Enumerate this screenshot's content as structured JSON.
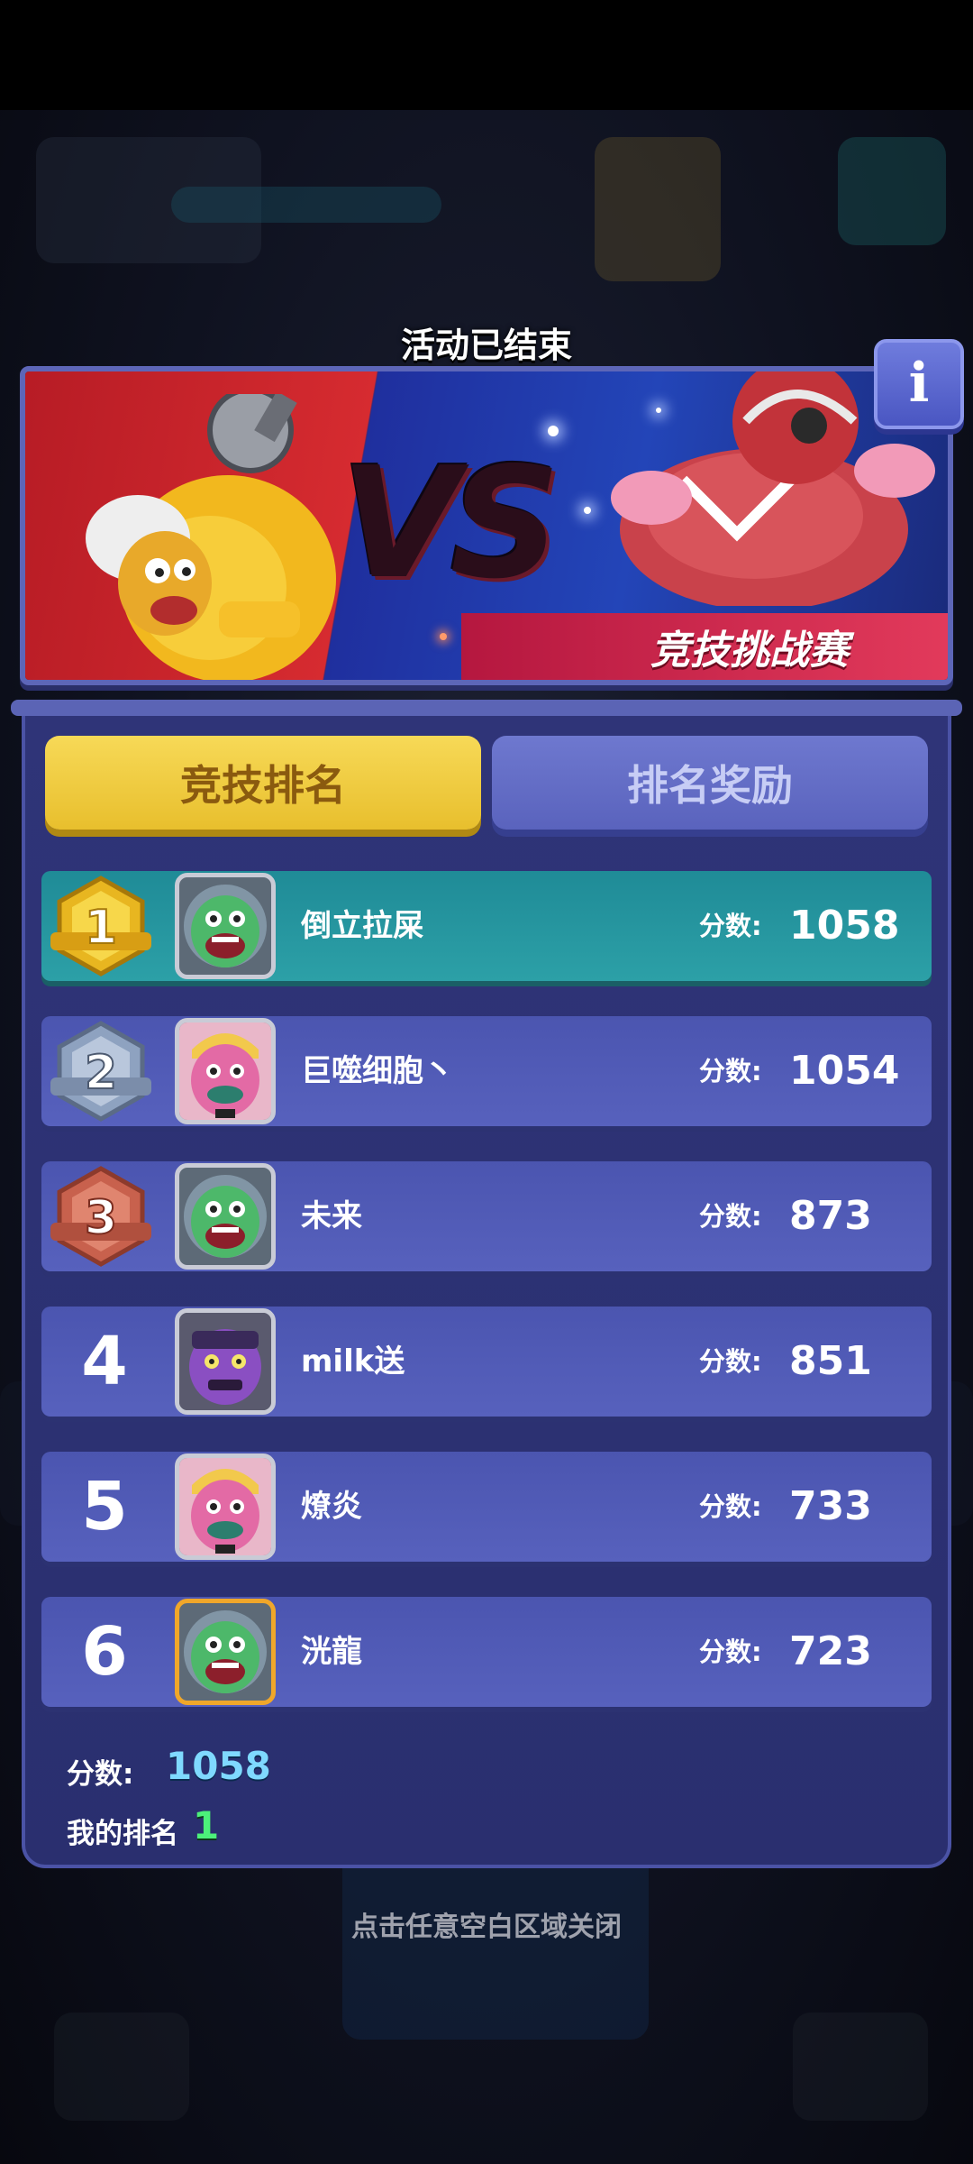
{
  "header": {
    "status": "活动已结束"
  },
  "banner": {
    "vs": "VS",
    "tag": "竞技挑战赛",
    "info_label": "i"
  },
  "tabs": [
    {
      "label": "竞技排名",
      "active": true
    },
    {
      "label": "排名奖励",
      "active": false
    }
  ],
  "score_label": "分数:",
  "rows": [
    {
      "rank": "1",
      "name": "倒立拉屎",
      "score": "1058",
      "badge": "gold"
    },
    {
      "rank": "2",
      "name": "巨噬细胞丶",
      "score": "1054",
      "badge": "silver"
    },
    {
      "rank": "3",
      "name": "未来",
      "score": "873",
      "badge": "bronze"
    },
    {
      "rank": "4",
      "name": "milk送",
      "score": "851"
    },
    {
      "rank": "5",
      "name": "燎炎",
      "score": "733"
    },
    {
      "rank": "6",
      "name": "洸龍",
      "score": "723"
    }
  ],
  "me": {
    "score_label": "分数:",
    "score": "1058",
    "rank_label": "我的排名",
    "rank": "1"
  },
  "footer": {
    "close_hint": "点击任意空白区域关闭"
  },
  "colors": {
    "accent_gold": "#f7d957",
    "first_row": "#1f8b97",
    "row": "#5761bd",
    "my_score": "#7fd9ff",
    "my_rank": "#4cf07a"
  }
}
